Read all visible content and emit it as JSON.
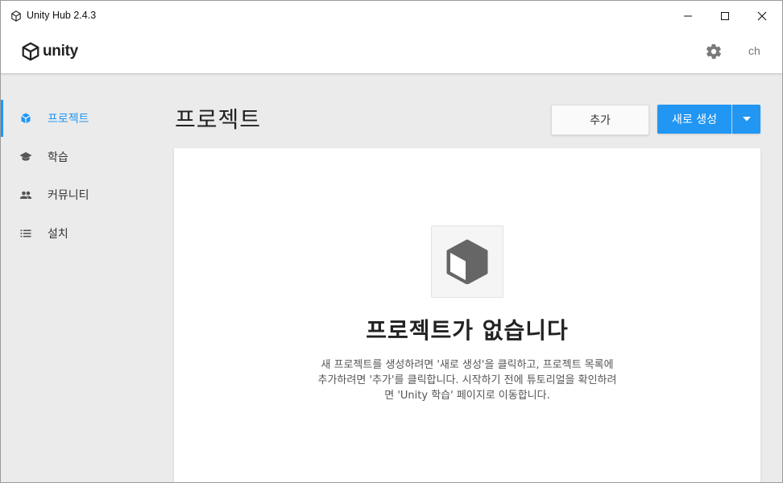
{
  "window": {
    "title": "Unity Hub 2.4.3",
    "controls": [
      "minimize",
      "maximize",
      "close"
    ]
  },
  "header": {
    "logo_text": "unity",
    "settings_icon": "gear-icon",
    "user_initials": "ch"
  },
  "sidebar": {
    "items": [
      {
        "label": "프로젝트",
        "icon": "cube-icon",
        "active": true
      },
      {
        "label": "학습",
        "icon": "graduation-cap-icon",
        "active": false
      },
      {
        "label": "커뮤니티",
        "icon": "people-icon",
        "active": false
      },
      {
        "label": "설치",
        "icon": "list-icon",
        "active": false
      }
    ]
  },
  "main": {
    "title": "프로젝트",
    "add_button": "추가",
    "new_button": "새로 생성",
    "empty_state": {
      "title": "프로젝트가 없습니다",
      "description_lines": [
        "새 프로젝트를 생성하려면 '새로 생성'을 클릭하고, 프로젝트 목록에",
        "추가하려면 '추가'를 클릭합니다. 시작하기 전에 튜토리얼을 확인하려",
        "면 'Unity 학습' 페이지로 이동합니다."
      ]
    }
  },
  "colors": {
    "accent": "#2196f3",
    "background": "#ebebeb",
    "panel": "#ffffff"
  }
}
